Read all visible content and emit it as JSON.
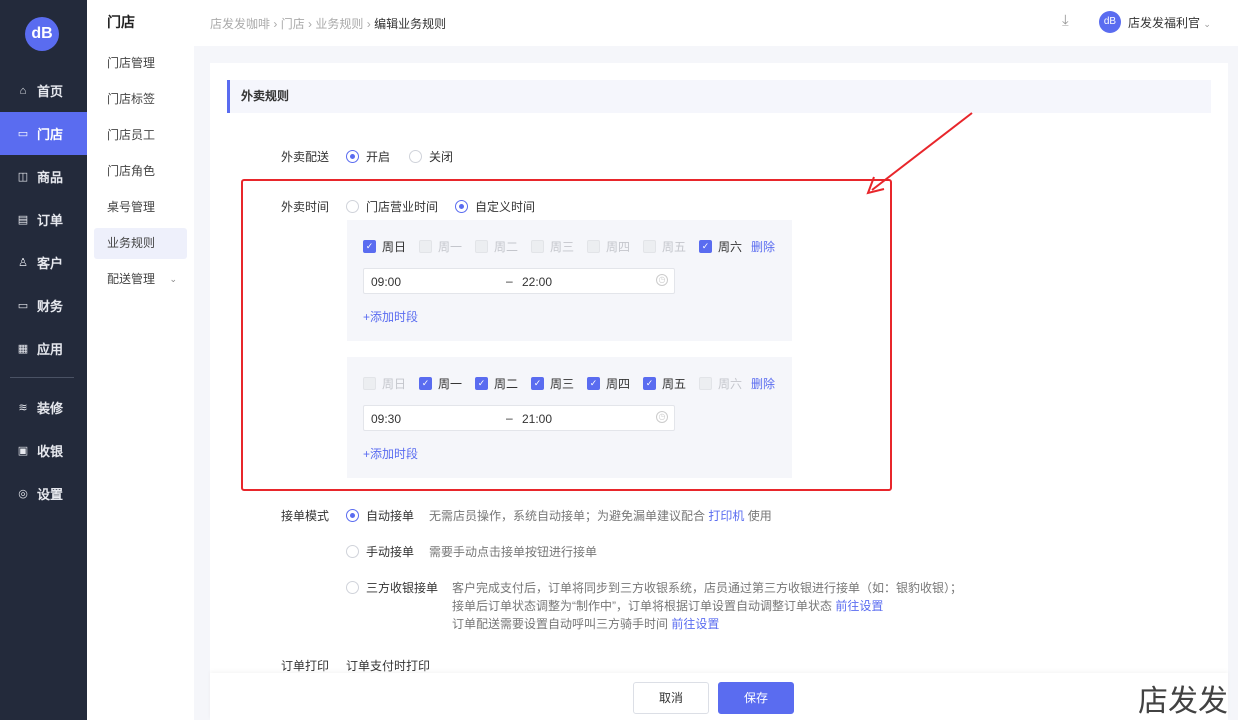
{
  "logo": "dB",
  "nav": [
    {
      "label": "首页",
      "icon": "⌂"
    },
    {
      "label": "门店",
      "icon": "▭",
      "active": true
    },
    {
      "label": "商品",
      "icon": "◫"
    },
    {
      "label": "订单",
      "icon": "▤"
    },
    {
      "label": "客户",
      "icon": "♙"
    },
    {
      "label": "财务",
      "icon": "▭"
    },
    {
      "label": "应用",
      "icon": "▦"
    },
    {
      "label": "装修",
      "icon": "≋"
    },
    {
      "label": "收银",
      "icon": "▣"
    },
    {
      "label": "设置",
      "icon": "◎"
    }
  ],
  "submenu": {
    "title": "门店",
    "items": [
      "门店管理",
      "门店标签",
      "门店员工",
      "门店角色",
      "桌号管理",
      "业务规则",
      "配送管理"
    ]
  },
  "breadcrumb": [
    "店发发咖啡",
    "门店",
    "业务规则",
    "编辑业务规则"
  ],
  "user": {
    "name": "店发发福利官"
  },
  "section": "外卖规则",
  "delivery": {
    "label": "外卖配送",
    "options": [
      "开启",
      "关闭"
    ],
    "selected": 0
  },
  "time": {
    "label": "外卖时间",
    "options": [
      "门店营业时间",
      "自定义时间"
    ],
    "selected": 1,
    "groups": [
      {
        "days": [
          {
            "name": "周日",
            "on": true
          },
          {
            "name": "周一",
            "on": false
          },
          {
            "name": "周二",
            "on": false
          },
          {
            "name": "周三",
            "on": false
          },
          {
            "name": "周四",
            "on": false
          },
          {
            "name": "周五",
            "on": false
          },
          {
            "name": "周六",
            "on": true
          }
        ],
        "start": "09:00",
        "end": "22:00"
      },
      {
        "days": [
          {
            "name": "周日",
            "on": false
          },
          {
            "name": "周一",
            "on": true
          },
          {
            "name": "周二",
            "on": true
          },
          {
            "name": "周三",
            "on": true
          },
          {
            "name": "周四",
            "on": true
          },
          {
            "name": "周五",
            "on": true
          },
          {
            "name": "周六",
            "on": false
          }
        ],
        "start": "09:30",
        "end": "21:00"
      }
    ],
    "delete": "删除",
    "add": "+添加时段",
    "sep": "–"
  },
  "mode": {
    "label": "接单模式",
    "auto": {
      "label": "自动接单",
      "desc": "无需店员操作，系统自动接单；为避免漏单建议配合",
      "link": "打印机",
      "after": "使用"
    },
    "manual": {
      "label": "手动接单",
      "desc": "需要手动点击接单按钮进行接单"
    },
    "third": {
      "label": "三方收银接单",
      "line1": "客户完成支付后，订单将同步到三方收银系统，店员通过第三方收银进行接单（如：银豹收银）；",
      "line2": "接单后订单状态调整为“制作中”，订单将根据订单设置自动调整订单状态",
      "line3": "订单配送需要设置自动呼叫三方骑手时间",
      "link": "前往设置"
    }
  },
  "print": {
    "label": "订单打印",
    "value": "订单支付时打印"
  },
  "footer": {
    "cancel": "取消",
    "save": "保存"
  },
  "watermark": "店发发",
  "colors": {
    "accent": "#5a6cf0",
    "sidebar": "#232a3b",
    "annotation": "#e8262b"
  }
}
